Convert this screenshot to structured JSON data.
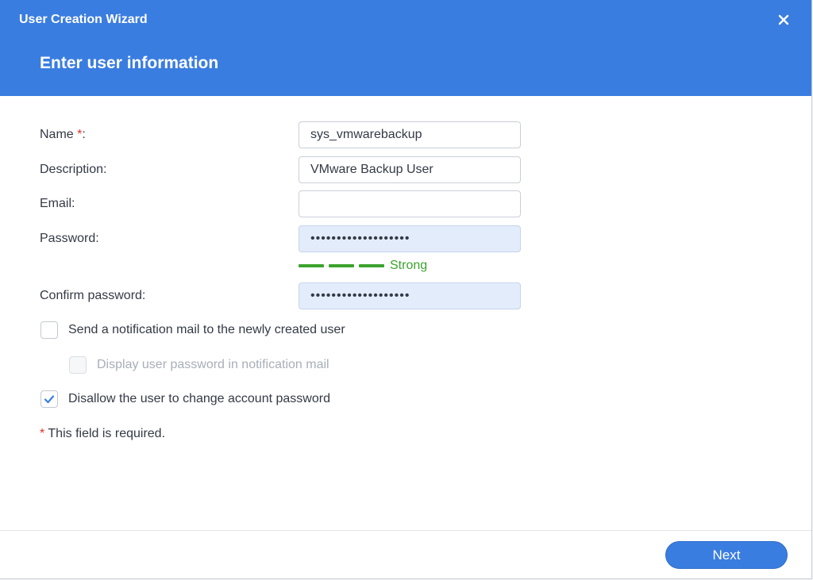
{
  "window": {
    "title": "User Creation Wizard"
  },
  "step": {
    "title": "Enter user information"
  },
  "form": {
    "name": {
      "label": "Name ",
      "required_mark": "*",
      "suffix": ":",
      "value": "sys_vmwarebackup"
    },
    "description": {
      "label": "Description:",
      "value": "VMware Backup User"
    },
    "email": {
      "label": "Email:",
      "value": ""
    },
    "password": {
      "label": "Password:",
      "masked_value": "•••••••••••••••••••"
    },
    "strength": {
      "label": "Strength: Strong",
      "text": "Strong",
      "color": "#3ba32d"
    },
    "confirm_password": {
      "label": "Confirm password:",
      "masked_value": "•••••••••••••••••••"
    }
  },
  "options": [
    {
      "label": "Send a notification mail to the newly created user",
      "checked": false,
      "disabled": false
    },
    {
      "label": "Display user password in notification mail",
      "checked": false,
      "disabled": true
    },
    {
      "label": "Disallow the user to change account password",
      "checked": true,
      "disabled": false
    }
  ],
  "required_note": {
    "mark": "*",
    "text": " This field is required."
  },
  "footer": {
    "next_label": "Next"
  },
  "colors": {
    "accent": "#3a7de0",
    "required": "#e0312b",
    "strength_strong": "#3ba32d"
  }
}
